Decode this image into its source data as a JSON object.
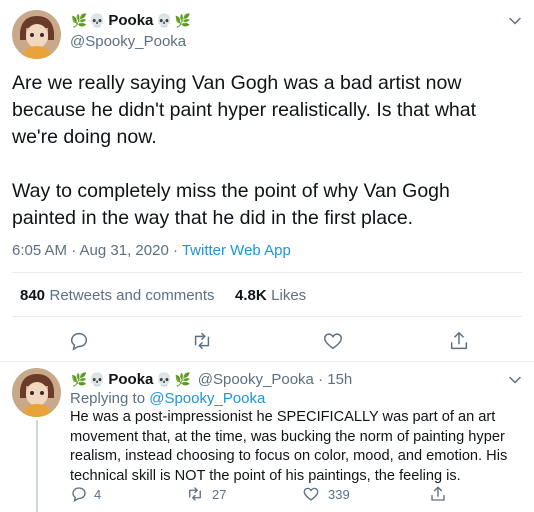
{
  "tweet": {
    "display_name": "Pooka",
    "handle": "@Spooky_Pooka",
    "text": "Are we really saying Van Gogh was a bad artist now because he didn't paint hyper realistically. Is that what we're doing now.\n\nWay to completely miss the point of why Van Gogh painted in the way that he did in the first place.",
    "time": "6:05 AM · Aug 31, 2020 · ",
    "app": "Twitter Web App",
    "retweets_count": "840",
    "retweets_label": "Retweets and comments",
    "likes_count": "4.8K",
    "likes_label": "Likes"
  },
  "reply": {
    "display_name": "Pooka",
    "handle_time": "@Spooky_Pooka · 15h",
    "replying_prefix": "Replying to ",
    "replying_handle": "@Spooky_Pooka",
    "text": "He was a post-impressionist he SPECIFICALLY was part of an art movement that, at the time, was bucking the norm of painting hyper realism, instead choosing to focus on color, mood, and emotion. His technical skill is NOT the point of his paintings, the feeling is.",
    "reply_count": "4",
    "retweet_count": "27",
    "like_count": "339"
  },
  "icons": {
    "name_decorations": [
      "herb",
      "skull",
      "skull",
      "herb"
    ],
    "actions": [
      "comment-icon",
      "retweet-icon",
      "like-icon",
      "share-icon"
    ]
  }
}
